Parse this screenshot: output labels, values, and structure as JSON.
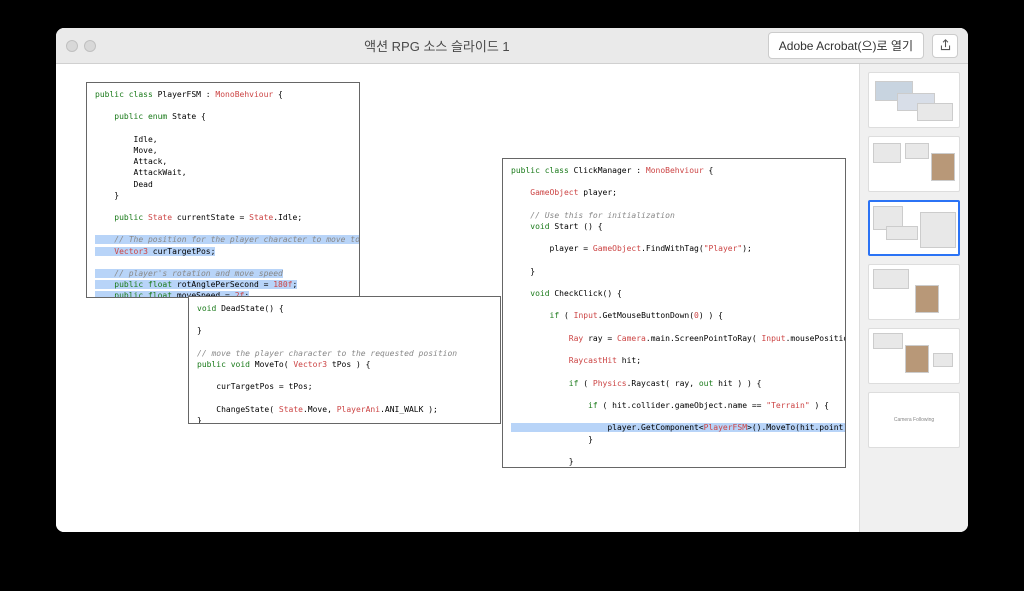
{
  "titlebar": {
    "title": "액션 RPG 소스 슬라이드 1",
    "open_label": "Adobe Acrobat(으)로 열기"
  },
  "code1": {
    "l1a": "public class",
    "l1b": " PlayerFSM",
    "l1c": " : ",
    "l1d": "MonoBehviour",
    "l1e": " {",
    "l2a": "    public enum",
    "l2b": " State {",
    "l3": "        Idle,",
    "l4": "        Move,",
    "l5": "        Attack,",
    "l6": "        AttackWait,",
    "l7": "        Dead",
    "l8": "    }",
    "l9a": "    public ",
    "l9b": "State",
    "l9c": " currentState = ",
    "l9d": "State",
    "l9e": ".Idle;",
    "l10": "    // The position for the player character to move to",
    "l11a": "    Vector3",
    "l11b": " curTargetPos;",
    "l12": "    // player's rotation and move speed",
    "l13a": "    public float",
    "l13b": " rotAnglePerSecond = ",
    "l13c": "180f",
    "l13d": ";",
    "l14a": "    public float",
    "l14b": " moveSpeed = ",
    "l14c": "2f",
    "l14d": ";"
  },
  "code2": {
    "l1a": "void",
    "l1b": " DeadState() {",
    "l2": "}",
    "l3": "// move the player character to the requested position",
    "l4a": "public void",
    "l4b": " MoveTo( ",
    "l4c": "Vector3",
    "l4d": " tPos ) {",
    "l5": "    curTargetPos = tPos;",
    "l6a": "    ChangeState( ",
    "l6b": "State",
    "l6c": ".Move, ",
    "l6d": "PlayerAni",
    "l6e": ".ANI_WALK );",
    "l7": "}"
  },
  "code3": {
    "l1a": "public class",
    "l1b": " ClickManager",
    "l1c": " : ",
    "l1d": "MonoBehviour",
    "l1e": " {",
    "l2a": "    GameObject",
    "l2b": " player;",
    "l3": "    // Use this for initialization",
    "l4a": "    void",
    "l4b": " Start () {",
    "l5a": "        player = ",
    "l5b": "GameObject",
    "l5c": ".FindWithTag(",
    "l5d": "\"Player\"",
    "l5e": ");",
    "l6": "    }",
    "l7a": "    void",
    "l7b": " CheckClick() {",
    "l8a": "        if",
    "l8b": " ( ",
    "l8c": "Input",
    "l8d": ".GetMouseButtonDown(",
    "l8e": "0",
    "l8f": ") ) {",
    "l9a": "            Ray",
    "l9b": " ray = ",
    "l9c": "Camera",
    "l9d": ".main.ScreenPointToRay( ",
    "l9e": "Input",
    "l9f": ".mousePosition );",
    "l10a": "            RaycastHit",
    "l10b": " hit;",
    "l11a": "            if",
    "l11b": " ( ",
    "l11c": "Physics",
    "l11d": ".Raycast( ray, ",
    "l11e": "out",
    "l11f": " hit ) ) {",
    "l12a": "                if",
    "l12b": " ( hit.collider.gameObject.name == ",
    "l12c": "\"Terrain\"",
    "l12d": " ) {",
    "l13a": "                    player.GetComponent<",
    "l13b": "PlayerFSM",
    "l13c": ">().MoveTo(hit.point);",
    "l14": "                }",
    "l15": "            }",
    "l16": "        }",
    "l17": "    }"
  },
  "thumbs": {
    "t6": "Camera Following"
  }
}
